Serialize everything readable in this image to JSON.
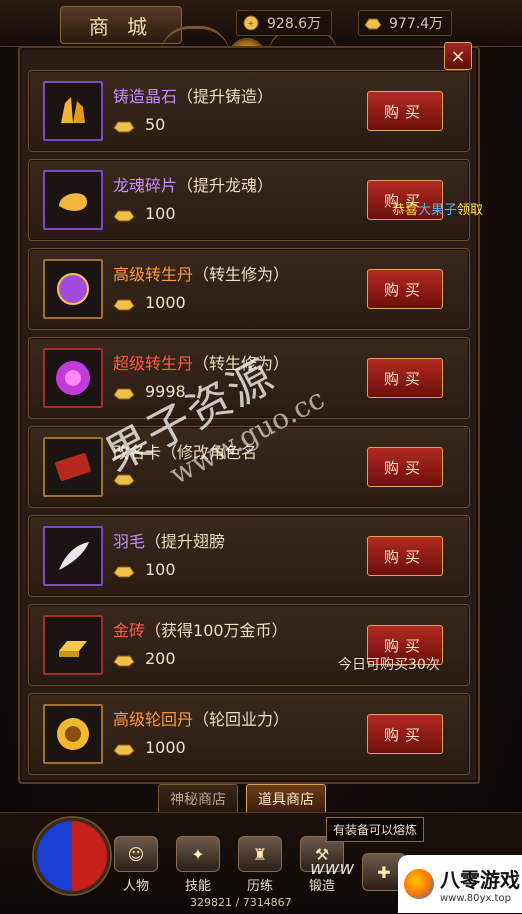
{
  "header": {
    "title": "商 城",
    "gold": "928.6万",
    "ingot": "977.4万",
    "close_label": "×"
  },
  "items": [
    {
      "title": "铸造晶石",
      "desc": "（提升铸造）",
      "price": "50",
      "buy_label": "购买",
      "color": "c-purple",
      "frame": "rare",
      "icon": "crystal-icon"
    },
    {
      "title": "龙魂碎片",
      "desc": "（提升龙魂）",
      "price": "100",
      "buy_label": "购买",
      "color": "c-purple",
      "frame": "rare",
      "icon": "dragon-soul-icon"
    },
    {
      "title": "高级转生丹",
      "desc": "（转生修为）",
      "price": "1000",
      "buy_label": "购买",
      "color": "c-orange",
      "frame": "",
      "icon": "orb-icon"
    },
    {
      "title": "超级转生丹",
      "desc": "（转生修为）",
      "price": "9998",
      "buy_label": "购买",
      "color": "c-red",
      "frame": "red",
      "icon": "rebirth-orb-icon"
    },
    {
      "title": "改名卡",
      "desc": "（修改角色名",
      "price": "",
      "buy_label": "购买",
      "color": "c-white",
      "frame": "",
      "icon": "rename-card-icon"
    },
    {
      "title": "羽毛",
      "desc": "（提升翅膀",
      "price": "100",
      "buy_label": "购买",
      "color": "c-purple",
      "frame": "rare",
      "icon": "feather-icon"
    },
    {
      "title": "金砖",
      "desc": "（获得100万金币）",
      "price": "200",
      "buy_label": "购买",
      "color": "c-red",
      "frame": "red",
      "icon": "gold-brick-icon"
    },
    {
      "title": "高级轮回丹",
      "desc": "（轮回业力）",
      "price": "1000",
      "buy_label": "购买",
      "color": "c-orange",
      "frame": "",
      "icon": "cycle-orb-icon"
    }
  ],
  "limit_text": "今日可购买30次",
  "marquee": {
    "prefix": "恭喜",
    "name": "大果子",
    "suffix": "领取"
  },
  "tabs": [
    {
      "label": "神秘商店",
      "active": false
    },
    {
      "label": "道具商店",
      "active": true
    }
  ],
  "nav": [
    {
      "label": "人物",
      "icon": "character-icon"
    },
    {
      "label": "技能",
      "icon": "skill-book-icon"
    },
    {
      "label": "历练",
      "icon": "armor-icon"
    },
    {
      "label": "锻造",
      "icon": "forge-icon"
    },
    {
      "label": "",
      "icon": "bag-icon"
    }
  ],
  "tooltip": "有装备可以熔炼",
  "exp_text": "329821 / 7314867",
  "watermark": {
    "main": "果子资源",
    "sub": "www.guo.cc",
    "corner": "www"
  },
  "logo": {
    "big": "八零游戏",
    "small": "www.80yx.top"
  }
}
